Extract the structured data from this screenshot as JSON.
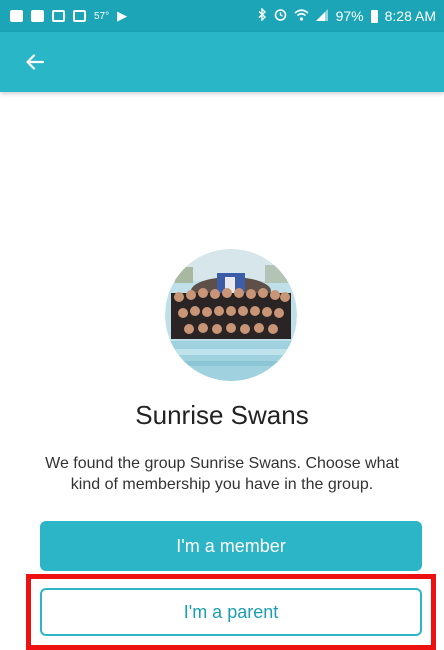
{
  "status_bar": {
    "notification_icons": [
      "news-icon",
      "facebook-icon",
      "gmail-icon",
      "gallery-icon"
    ],
    "temperature": "57°",
    "battery_percent": "97%",
    "time": "8:28 AM"
  },
  "app_bar": {
    "color": "#29b6c6"
  },
  "group": {
    "name": "Sunrise Swans",
    "description": "We found the group Sunrise Swans. Choose what kind of membership you have in the group."
  },
  "actions": {
    "member_label": "I'm a member",
    "parent_label": "I'm a parent"
  },
  "colors": {
    "accent": "#2bb5c6",
    "highlight": "#ee1111"
  }
}
